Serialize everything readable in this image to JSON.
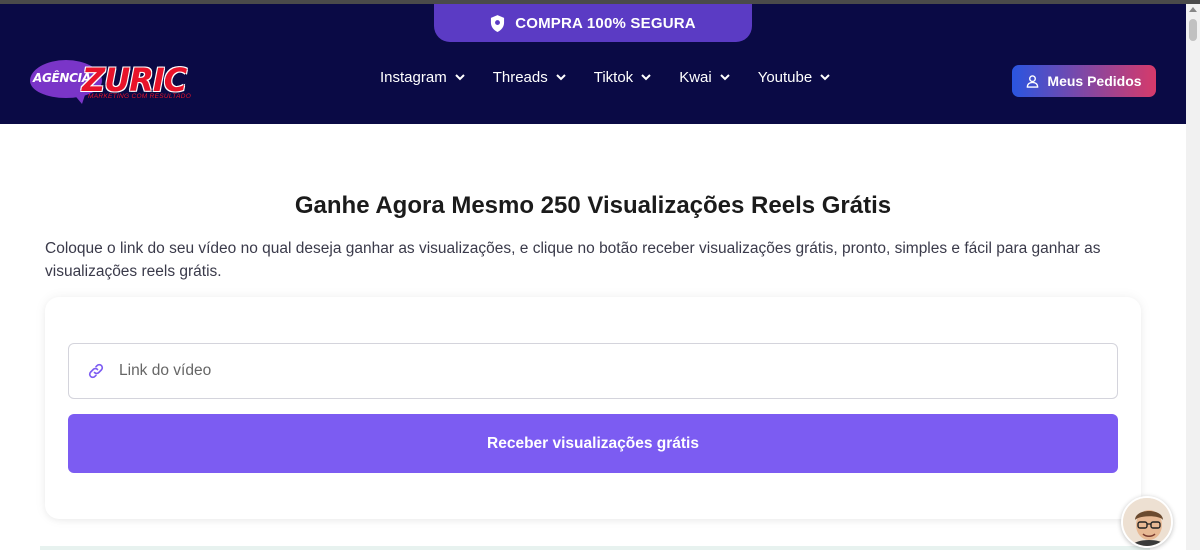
{
  "banner": {
    "secure_text": "COMPRA 100% SEGURA"
  },
  "logo": {
    "line1": "AGÊNCIA",
    "line2": "ZURIC",
    "tagline": "MARKETING COM RESULTADO"
  },
  "nav": {
    "items": [
      {
        "label": "Instagram"
      },
      {
        "label": "Threads"
      },
      {
        "label": "Tiktok"
      },
      {
        "label": "Kwai"
      },
      {
        "label": "Youtube"
      }
    ]
  },
  "header": {
    "orders_label": "Meus Pedidos"
  },
  "main": {
    "title": "Ganhe Agora Mesmo 250 Visualizações Reels Grátis",
    "description": "Coloque o link do seu vídeo no qual deseja ganhar as visualizações, e clique no botão receber visualizações grátis, pronto, simples e fácil para ganhar as visualizações reels grátis.",
    "form": {
      "link_placeholder": "Link do vídeo",
      "link_value": "",
      "submit_label": "Receber visualizações grátis"
    }
  },
  "colors": {
    "navbar_bg": "#0a0a45",
    "banner_bg": "#5b3bc4",
    "accent": "#7c5cf2",
    "brand_red": "#e8132a"
  },
  "icons": {
    "banner": "shield-icon",
    "dropdown": "chevron-down-icon",
    "orders": "user-icon",
    "input": "link-icon"
  }
}
